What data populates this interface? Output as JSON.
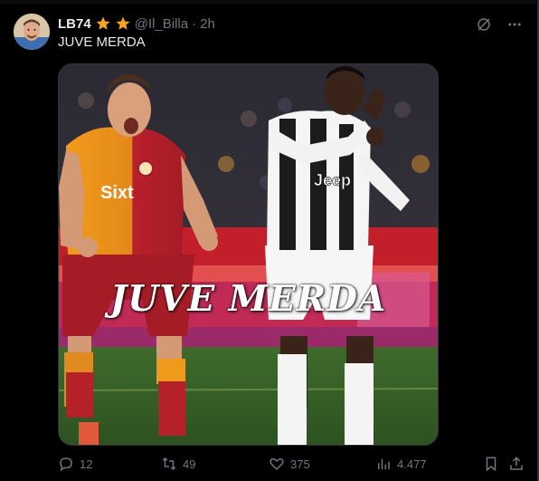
{
  "post": {
    "display_name": "LB74",
    "handle": "@Il_Billa",
    "separator": "·",
    "time": "2h",
    "text": "JUVE MERDA",
    "badges": [
      "star-icon",
      "star-icon"
    ]
  },
  "media": {
    "overlay_text": "JUVE MERDA",
    "left_player_sponsor": "Sixt",
    "right_player_sponsor": "Jeep"
  },
  "actions": {
    "replies": "12",
    "reposts": "49",
    "likes": "375",
    "views": "4.477"
  },
  "icons": {
    "top_right": [
      "grok-icon",
      "more-icon"
    ],
    "action_bar": [
      "reply-icon",
      "repost-icon",
      "like-icon",
      "views-icon",
      "bookmark-icon",
      "share-icon"
    ]
  },
  "colors": {
    "background": "#000000",
    "text_primary": "#e7e9ea",
    "text_secondary": "#71767b",
    "star": "#f5a623"
  }
}
